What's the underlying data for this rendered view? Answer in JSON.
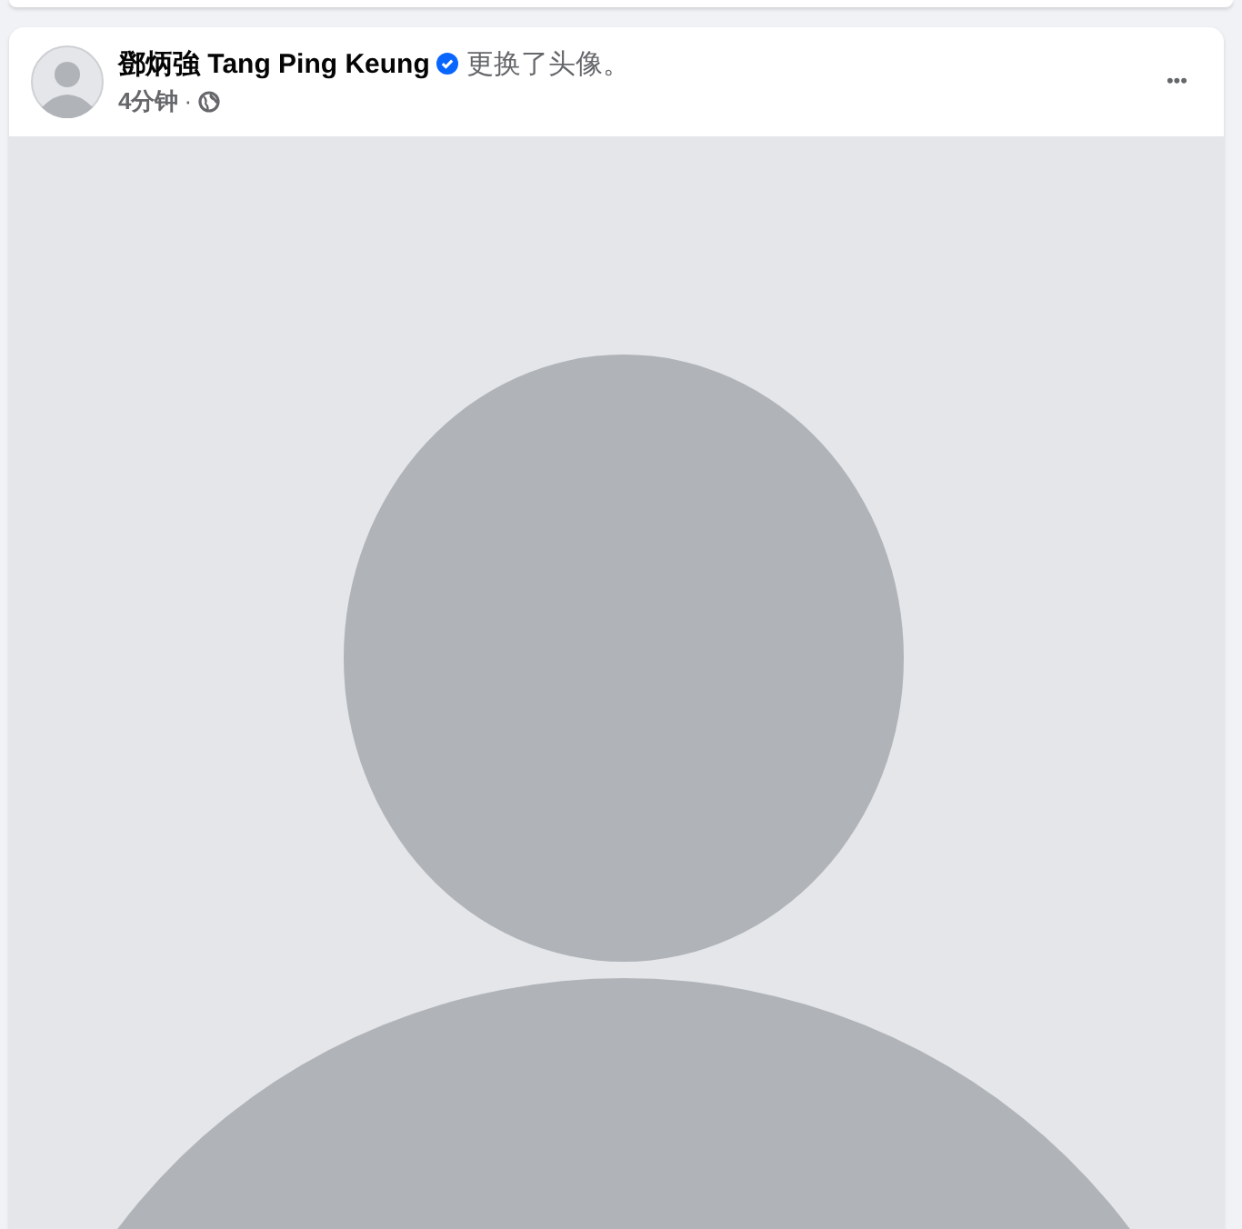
{
  "post": {
    "author": "鄧炳強 Tang Ping Keung",
    "verified": true,
    "action": "更换了头像。",
    "time": "4分钟",
    "separator": "·",
    "menu": "•••"
  }
}
